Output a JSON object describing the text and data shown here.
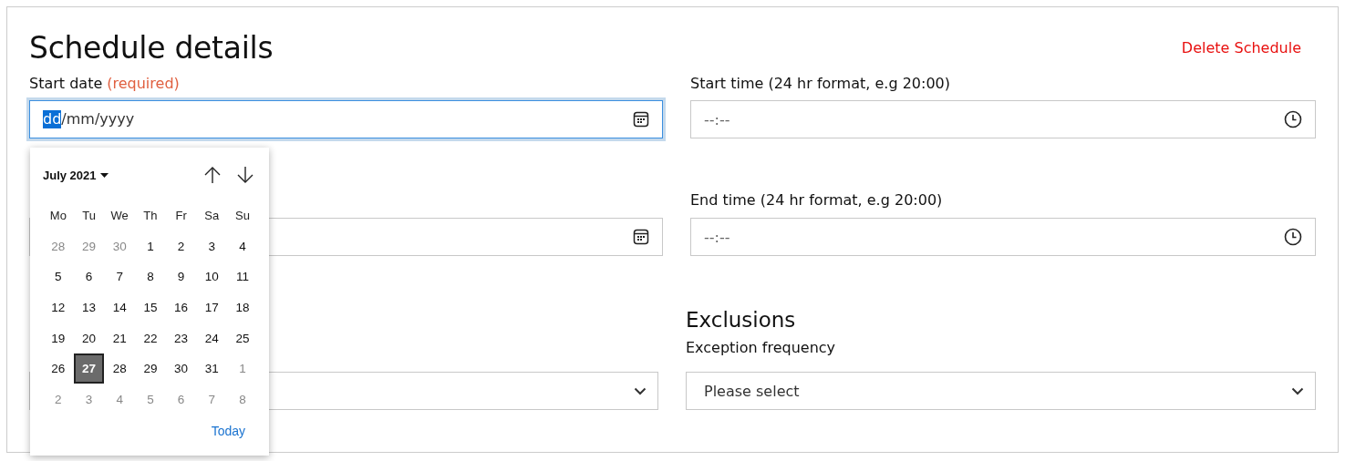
{
  "title": "Schedule details",
  "delete_link": "Delete Schedule",
  "start_date": {
    "label": "Start date",
    "required": "(required)",
    "focused": true,
    "segments": [
      {
        "text": "dd",
        "selected": true
      },
      {
        "text": "/",
        "selected": false
      },
      {
        "text": "mm",
        "selected": false
      },
      {
        "text": "/",
        "selected": false
      },
      {
        "text": "yyyy",
        "selected": false
      }
    ]
  },
  "start_time": {
    "label": "Start time (24 hr format, e.g 20:00)",
    "value": "--:--"
  },
  "end_time": {
    "label": "End time (24 hr format, e.g 20:00)",
    "value": "--:--"
  },
  "end_date": {
    "focused": false
  },
  "exclusions": {
    "heading": "Exclusions",
    "label": "Exception frequency",
    "value": "Please select"
  },
  "calendar": {
    "month": "July 2021",
    "weekdays": [
      "Mo",
      "Tu",
      "We",
      "Th",
      "Fr",
      "Sa",
      "Su"
    ],
    "today": "Today",
    "days": [
      {
        "text": "28",
        "muted": true,
        "selected": false
      },
      {
        "text": "29",
        "muted": true,
        "selected": false
      },
      {
        "text": "30",
        "muted": true,
        "selected": false
      },
      {
        "text": "1",
        "muted": false,
        "selected": false
      },
      {
        "text": "2",
        "muted": false,
        "selected": false
      },
      {
        "text": "3",
        "muted": false,
        "selected": false
      },
      {
        "text": "4",
        "muted": false,
        "selected": false
      },
      {
        "text": "5",
        "muted": false,
        "selected": false
      },
      {
        "text": "6",
        "muted": false,
        "selected": false
      },
      {
        "text": "7",
        "muted": false,
        "selected": false
      },
      {
        "text": "8",
        "muted": false,
        "selected": false
      },
      {
        "text": "9",
        "muted": false,
        "selected": false
      },
      {
        "text": "10",
        "muted": false,
        "selected": false
      },
      {
        "text": "11",
        "muted": false,
        "selected": false
      },
      {
        "text": "12",
        "muted": false,
        "selected": false
      },
      {
        "text": "13",
        "muted": false,
        "selected": false
      },
      {
        "text": "14",
        "muted": false,
        "selected": false
      },
      {
        "text": "15",
        "muted": false,
        "selected": false
      },
      {
        "text": "16",
        "muted": false,
        "selected": false
      },
      {
        "text": "17",
        "muted": false,
        "selected": false
      },
      {
        "text": "18",
        "muted": false,
        "selected": false
      },
      {
        "text": "19",
        "muted": false,
        "selected": false
      },
      {
        "text": "20",
        "muted": false,
        "selected": false
      },
      {
        "text": "21",
        "muted": false,
        "selected": false
      },
      {
        "text": "22",
        "muted": false,
        "selected": false
      },
      {
        "text": "23",
        "muted": false,
        "selected": false
      },
      {
        "text": "24",
        "muted": false,
        "selected": false
      },
      {
        "text": "25",
        "muted": false,
        "selected": false
      },
      {
        "text": "26",
        "muted": false,
        "selected": false
      },
      {
        "text": "27",
        "muted": false,
        "selected": true
      },
      {
        "text": "28",
        "muted": false,
        "selected": false
      },
      {
        "text": "29",
        "muted": false,
        "selected": false
      },
      {
        "text": "30",
        "muted": false,
        "selected": false
      },
      {
        "text": "31",
        "muted": false,
        "selected": false
      },
      {
        "text": "1",
        "muted": true,
        "selected": false
      },
      {
        "text": "2",
        "muted": true,
        "selected": false
      },
      {
        "text": "3",
        "muted": true,
        "selected": false
      },
      {
        "text": "4",
        "muted": true,
        "selected": false
      },
      {
        "text": "5",
        "muted": true,
        "selected": false
      },
      {
        "text": "6",
        "muted": true,
        "selected": false
      },
      {
        "text": "7",
        "muted": true,
        "selected": false
      },
      {
        "text": "8",
        "muted": true,
        "selected": false
      }
    ]
  }
}
